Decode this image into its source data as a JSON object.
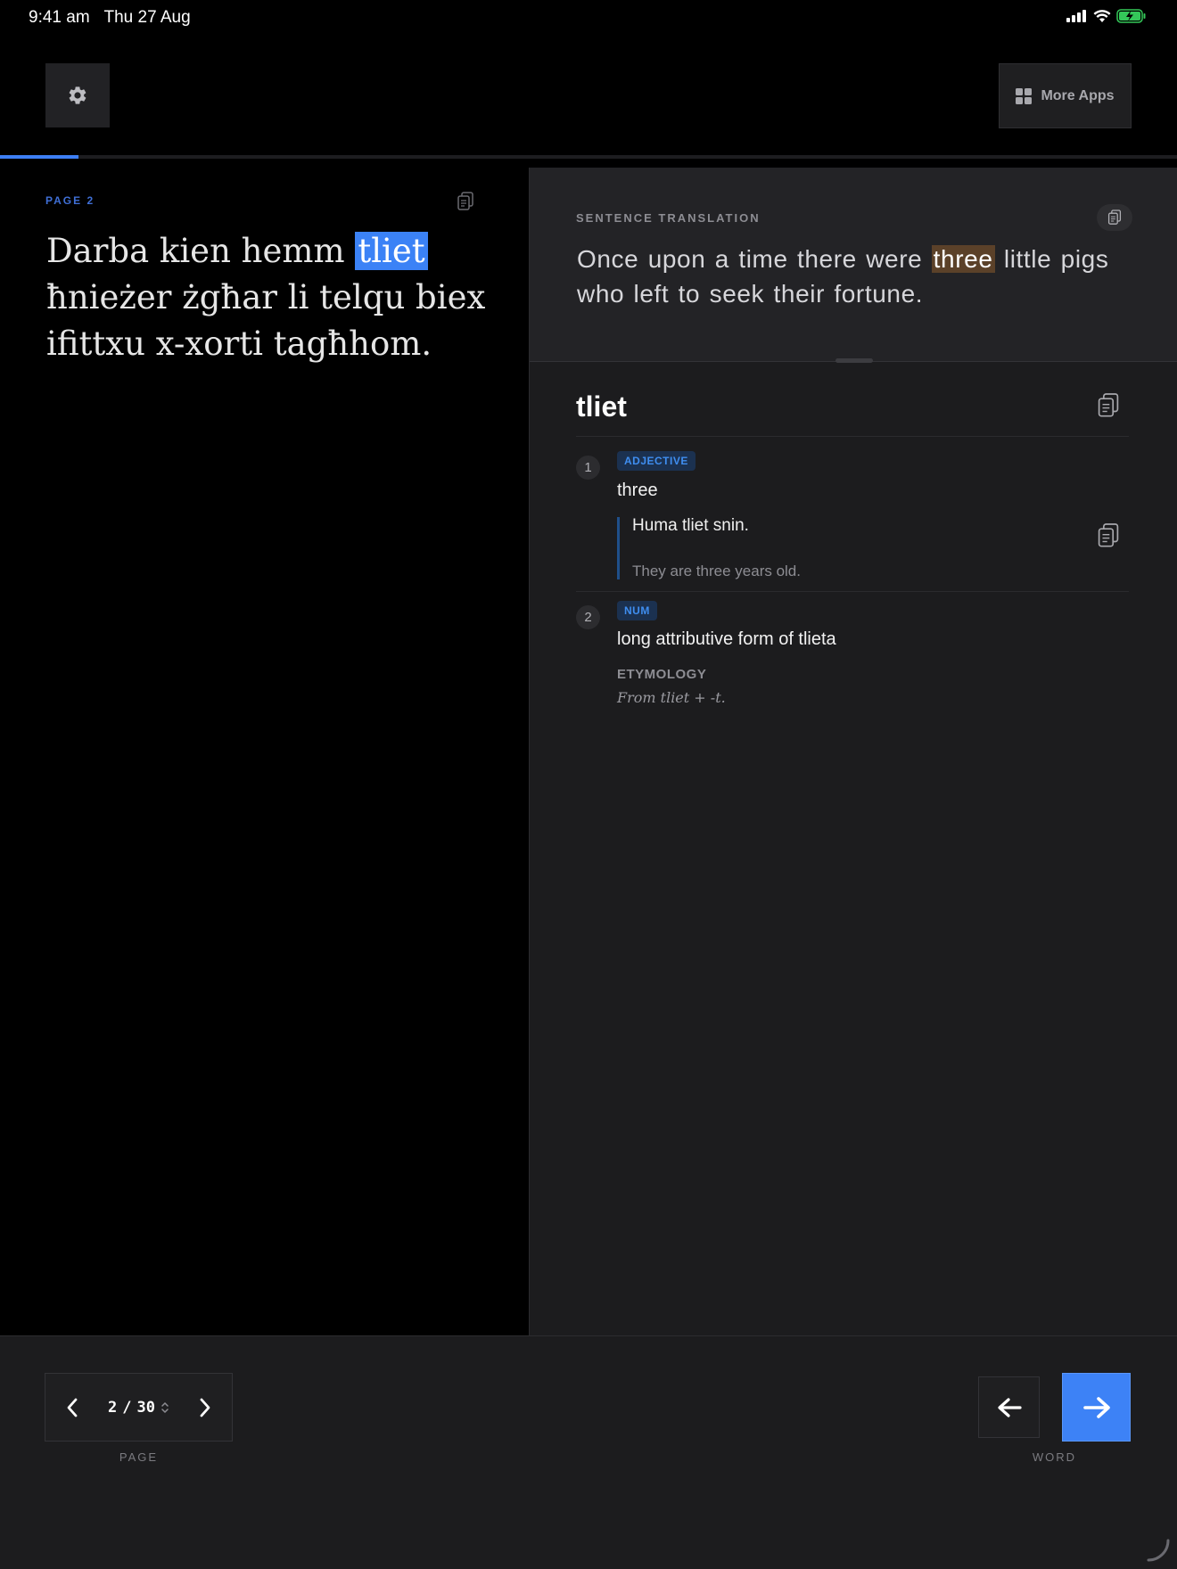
{
  "status_bar": {
    "time": "9:41 am",
    "date": "Thu 27 Aug",
    "battery_color": "#34c759"
  },
  "top_bar": {
    "settings_icon": "gear-icon",
    "more_apps_icon": "grid-icon",
    "more_apps_label": "More Apps"
  },
  "reading_progress": {
    "fraction": 0.067,
    "color": "#3d7ff5"
  },
  "source": {
    "page_label": "PAGE 2",
    "copy_icon": "copy-icon",
    "text_before": "Darba kien hemm ",
    "highlighted_word": "tliet",
    "text_after": " ħnieżer żgħar li telqu biex ifittxu x-xorti tagħhom."
  },
  "translation": {
    "label": "SENTENCE TRANSLATION",
    "copy_icon": "copy-icon",
    "text_before": "Once upon a time there were ",
    "highlighted_word": "three",
    "text_after": " little pigs who left to seek their fortune.",
    "highlight_color": "#5b4129"
  },
  "dictionary": {
    "headword": "tliet",
    "copy_icon": "copy-icon",
    "senses": [
      {
        "number": "1",
        "pos": "ADJECTIVE",
        "gloss": "three",
        "example": "Huma tliet snin.",
        "example_translation": "They are three years old."
      },
      {
        "number": "2",
        "pos": "NUM",
        "gloss": "long attributive form of tlieta"
      }
    ],
    "etymology_label": "ETYMOLOGY",
    "etymology_text": "From tliet + -t."
  },
  "bottom_bar": {
    "page_current": "2",
    "page_separator": "/",
    "page_total": "30",
    "page_caption": "PAGE",
    "word_caption": "WORD",
    "word_prev_icon": "arrow-left-icon",
    "word_next_icon": "arrow-right-icon",
    "accent_color": "#3d82f6"
  }
}
